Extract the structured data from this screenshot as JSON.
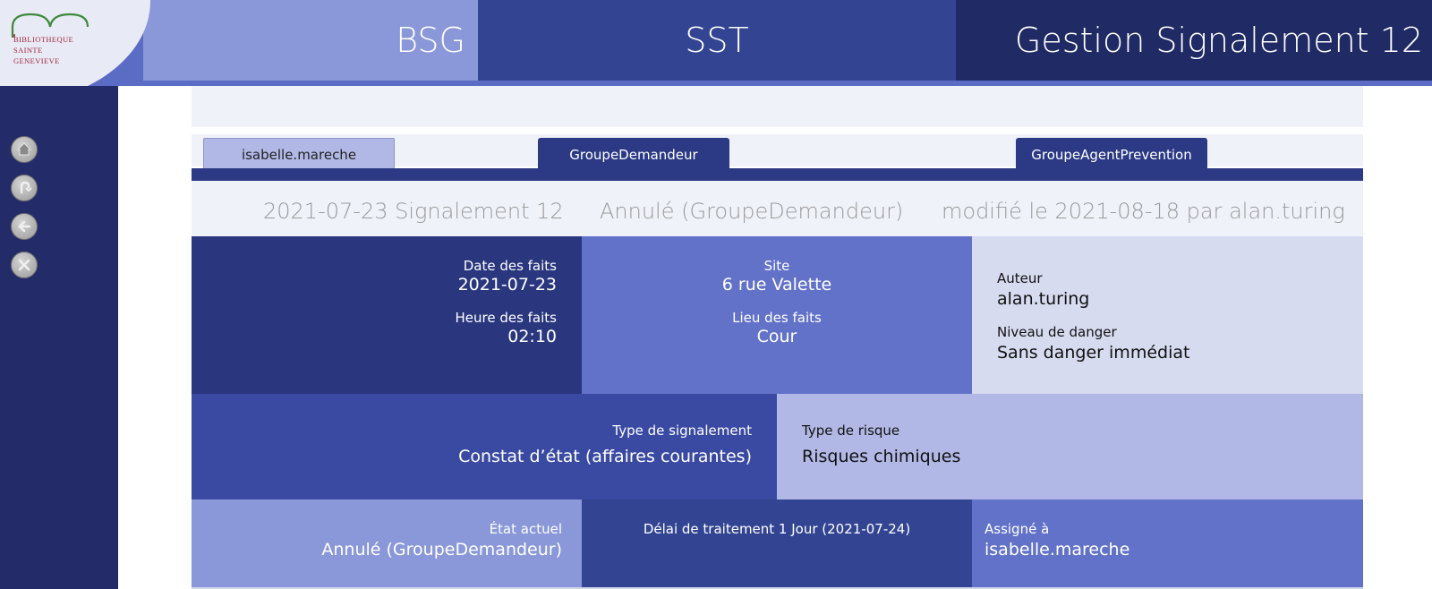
{
  "logo": {
    "line1": "BIBLIOTHEQUE",
    "line2": "SAINTE",
    "line3": "GENEVIEVE"
  },
  "header": {
    "bsg": "BSG",
    "sst": "SST",
    "title": "Gestion Signalement 12"
  },
  "sidebar": {
    "buttons": [
      "home-icon",
      "back-history-icon",
      "back-arrow-icon",
      "close-icon"
    ]
  },
  "tabs": {
    "user": "isabelle.mareche",
    "demandeur": "GroupeDemandeur",
    "agent": "GroupeAgentPrevention"
  },
  "summary": {
    "left": "2021-07-23 Signalement 12",
    "middle": "Annulé (GroupeDemandeur)",
    "right": "modifié le 2021-08-18 par alan.turing"
  },
  "details": {
    "date_label": "Date des faits",
    "date_value": "2021-07-23",
    "heure_label": "Heure des faits",
    "heure_value": "02:10",
    "site_label": "Site",
    "site_value": "6 rue Valette",
    "lieu_label": "Lieu des faits",
    "lieu_value": "Cour",
    "auteur_label": "Auteur",
    "auteur_value": "alan.turing",
    "danger_label": "Niveau de danger",
    "danger_value": "Sans danger immédiat",
    "type_label": "Type de signalement",
    "type_value": "Constat d’état (affaires courantes)",
    "risque_label": "Type de risque",
    "risque_value": "Risques chimiques",
    "etat_label": "État actuel",
    "etat_value": "Annulé (GroupeDemandeur)",
    "delai_label": "Délai de traitement 1 Jour (2021-07-24)",
    "assigne_label": "Assigné à",
    "assigne_value": "isabelle.mareche"
  },
  "colors": {
    "header_dark": "#202a64",
    "header_mid": "#334592",
    "header_light": "#8a97d8",
    "sidebar": "#232c68",
    "accent": "#6272c8",
    "pale": "#f0f2fa"
  }
}
